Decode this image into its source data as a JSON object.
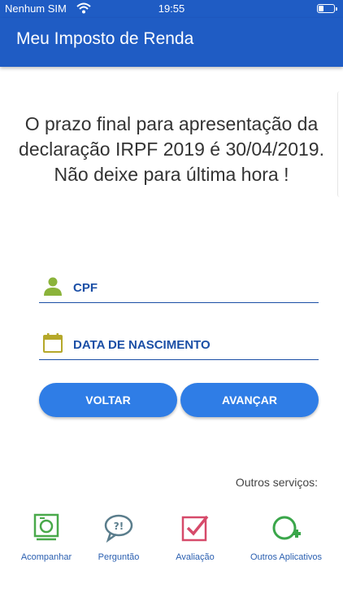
{
  "status_bar": {
    "carrier": "Nenhum SIM",
    "time": "19:55",
    "battery_level": 0.3
  },
  "app_bar": {
    "title": "Meu Imposto de Renda"
  },
  "notice": {
    "text": "O prazo final para apresentação da declaração IRPF 2019 é 30/04/2019. Não deixe para última hora !"
  },
  "form": {
    "cpf": {
      "label": "CPF",
      "icon": "person-icon",
      "color": "#8bb33a"
    },
    "birth_date": {
      "label": "DATA DE NASCIMENTO",
      "icon": "calendar-icon",
      "color": "#b5a82a"
    }
  },
  "buttons": {
    "back": "VOLTAR",
    "next": "AVANÇAR"
  },
  "other_services": {
    "heading": "Outros serviços:",
    "items": [
      {
        "label": "Acompanhar",
        "icon": "monitor-icon",
        "color": "#49a94a"
      },
      {
        "label": "Perguntão",
        "icon": "question-chat-icon",
        "color": "#5a7d8c"
      },
      {
        "label": "Avaliação",
        "icon": "checkbox-icon",
        "color": "#d64a6a"
      },
      {
        "label": "Outros Aplicativos",
        "icon": "add-circle-icon",
        "color": "#3aa64a"
      }
    ]
  },
  "colors": {
    "primary": "#1f5cc4",
    "button": "#2f7de6",
    "field_line": "#1b4fa6"
  }
}
